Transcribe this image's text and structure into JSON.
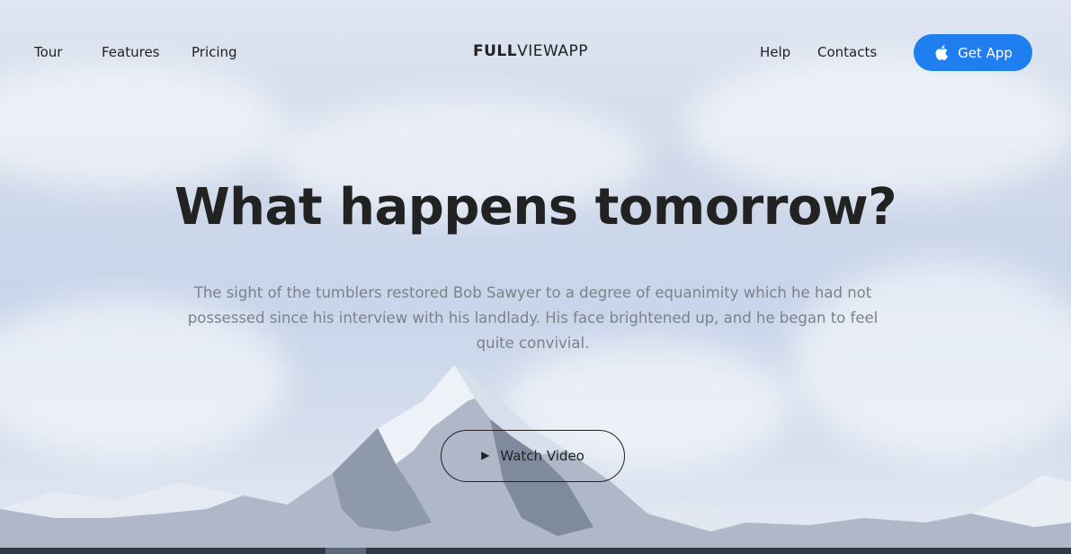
{
  "nav": {
    "left": [
      "Tour",
      "Features",
      "Pricing"
    ],
    "logo_bold": "FULL",
    "logo_light": "VIEWAPP",
    "right": [
      "Help",
      "Contacts"
    ],
    "cta_label": "Get App"
  },
  "hero": {
    "headline": "What happens tomorrow?",
    "lede": "The sight of the tumblers restored Bob Sawyer to a degree of equanimity which he had not possessed since his interview with his landlady. His face brightened up, and he began to feel quite convivial.",
    "video_button": "Watch Video",
    "video_icon": "play-icon"
  },
  "colors": {
    "accent": "#1f7ef0",
    "text": "#222222",
    "muted": "#7d8188"
  },
  "icons": {
    "cta": "apple-icon"
  }
}
